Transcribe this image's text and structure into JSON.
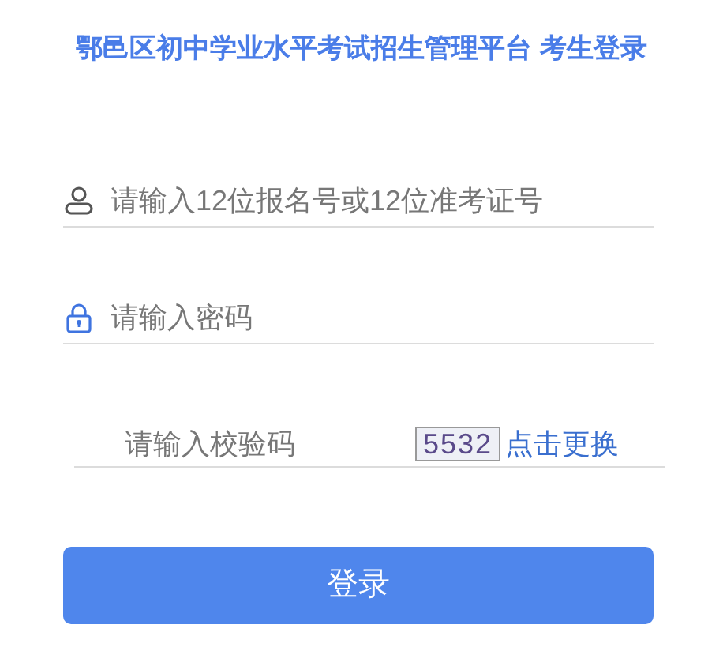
{
  "title": "鄂邑区初中学业水平考试招生管理平台 考生登录",
  "fields": [
    {
      "kind": "user",
      "placeholder": "请输入12位报名号或12位准考证号"
    },
    {
      "kind": "password",
      "placeholder": "请输入密码"
    }
  ],
  "captcha": {
    "placeholder": "请输入校验码",
    "code": "5532",
    "refresh_link": "点击更换"
  },
  "login_button": "登录"
}
